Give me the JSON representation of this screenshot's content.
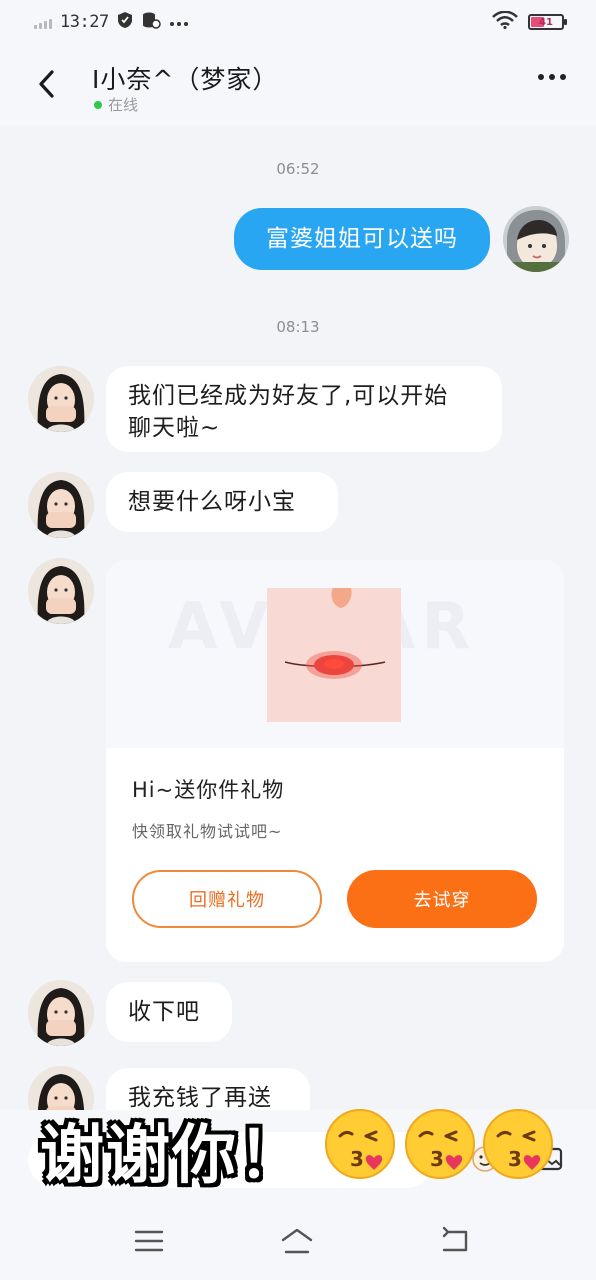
{
  "status_bar": {
    "time": "13:27",
    "icons": [
      "signal-icon",
      "shield-icon",
      "data-saver-icon",
      "more-dots-icon"
    ],
    "right_icons": [
      "wifi-icon",
      "battery-icon"
    ],
    "battery_level": "41",
    "battery_color": "#e84a7a"
  },
  "header": {
    "contact_name": "I小奈^（梦家）",
    "online_status": "在线",
    "online_color": "#2ec84a"
  },
  "chat": {
    "timestamps": [
      "06:52",
      "08:13"
    ],
    "my_message": "富婆姐姐可以送吗",
    "messages": [
      {
        "line1": "我们已经成为好友了,可以开始",
        "line2": "聊天啦~"
      },
      {
        "text": "想要什么呀小宝"
      },
      {
        "text": "收下吧"
      },
      {
        "text": "我充钱了再送"
      }
    ],
    "gift": {
      "watermark": "AVATAR",
      "title": "Hi~送你件礼物",
      "subtitle": "快领取礼物试试吧~",
      "return_gift_label": "回赠礼物",
      "try_on_label": "去试穿",
      "accent_color": "#fb6f15"
    },
    "my_bubble_color": "#29a6f2"
  },
  "overlay": {
    "caption": "谢谢你！",
    "emojis": [
      "kissing-face-icon",
      "kissing-face-icon",
      "kissing-face-icon"
    ]
  },
  "nav": {
    "menu_icon": "menu-icon",
    "home_icon": "home-icon",
    "back_icon": "back-nav-icon"
  }
}
